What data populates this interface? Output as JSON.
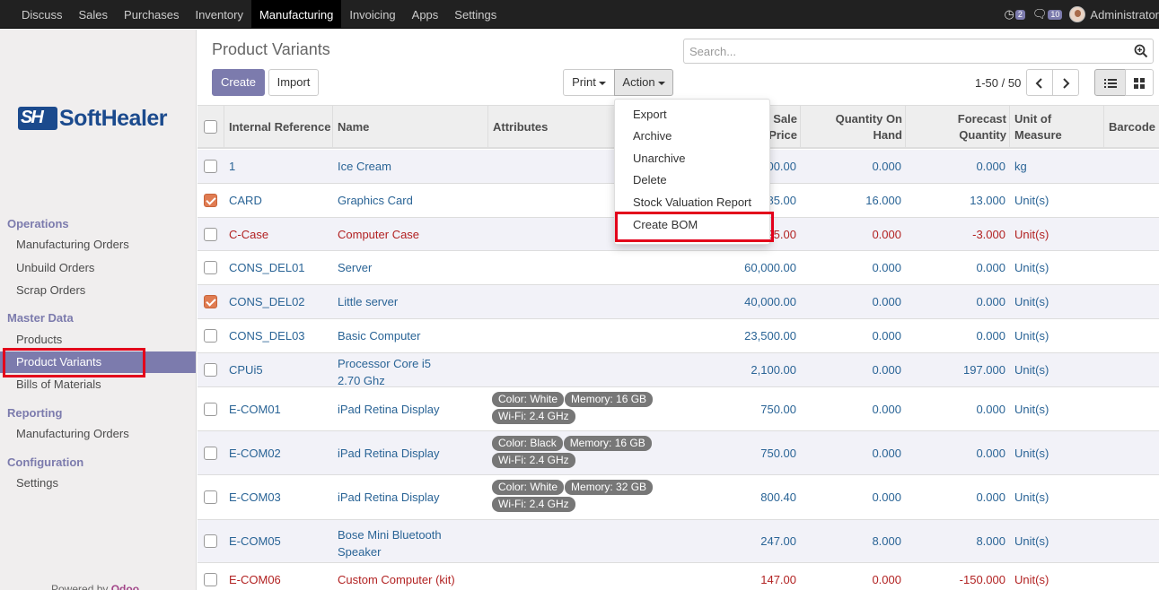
{
  "topbar": {
    "menus": [
      "Discuss",
      "Sales",
      "Purchases",
      "Inventory",
      "Manufacturing",
      "Invoicing",
      "Apps",
      "Settings"
    ],
    "active_menu": "Manufacturing",
    "activity_count": "2",
    "messages_count": "10",
    "user_name": "Administrator"
  },
  "sidebar": {
    "logo_text": "SoftHealer",
    "sections": [
      {
        "title": "Operations",
        "items": [
          "Manufacturing Orders",
          "Unbuild Orders",
          "Scrap Orders"
        ]
      },
      {
        "title": "Master Data",
        "items": [
          "Products",
          "Product Variants",
          "Bills of Materials"
        ]
      },
      {
        "title": "Reporting",
        "items": [
          "Manufacturing Orders"
        ]
      },
      {
        "title": "Configuration",
        "items": [
          "Settings"
        ]
      }
    ],
    "active_item": "Product Variants",
    "powered_by": "Powered by",
    "powered_brand": "Odoo"
  },
  "control": {
    "title": "Product Variants",
    "search_placeholder": "Search...",
    "create_label": "Create",
    "import_label": "Import",
    "print_label": "Print",
    "action_label": "Action",
    "pager": "1-50 / 50"
  },
  "action_menu": {
    "items": [
      "Export",
      "Archive",
      "Unarchive",
      "Delete",
      "Stock Valuation Report",
      "Create BOM"
    ],
    "highlighted": "Create BOM"
  },
  "table": {
    "headers": {
      "ref": "Internal Reference",
      "name": "Name",
      "attributes": "Attributes",
      "price": "Sale Price",
      "qty": "Quantity On Hand",
      "forecast": "Forecast Quantity",
      "uom": "Unit of Measure",
      "barcode": "Barcode"
    },
    "rows": [
      {
        "ref": "1",
        "name": "Ice Cream",
        "tags": [],
        "price": "100.00",
        "qty": "0.000",
        "forecast": "0.000",
        "uom": "kg",
        "checked": false,
        "red": false
      },
      {
        "ref": "CARD",
        "name": "Graphics Card",
        "tags": [],
        "price": "885.00",
        "qty": "16.000",
        "forecast": "13.000",
        "uom": "Unit(s)",
        "checked": true,
        "red": false
      },
      {
        "ref": "C-Case",
        "name": "Computer Case",
        "tags": [],
        "price": "25.00",
        "qty": "0.000",
        "forecast": "-3.000",
        "uom": "Unit(s)",
        "checked": false,
        "red": true
      },
      {
        "ref": "CONS_DEL01",
        "name": "Server",
        "tags": [],
        "price": "60,000.00",
        "qty": "0.000",
        "forecast": "0.000",
        "uom": "Unit(s)",
        "checked": false,
        "red": false
      },
      {
        "ref": "CONS_DEL02",
        "name": "Little server",
        "tags": [],
        "price": "40,000.00",
        "qty": "0.000",
        "forecast": "0.000",
        "uom": "Unit(s)",
        "checked": true,
        "red": false
      },
      {
        "ref": "CONS_DEL03",
        "name": "Basic Computer",
        "tags": [],
        "price": "23,500.00",
        "qty": "0.000",
        "forecast": "0.000",
        "uom": "Unit(s)",
        "checked": false,
        "red": false
      },
      {
        "ref": "CPUi5",
        "name": "Processor Core i5 2.70 Ghz",
        "tags": [],
        "price": "2,100.00",
        "qty": "0.000",
        "forecast": "197.000",
        "uom": "Unit(s)",
        "checked": false,
        "red": false
      },
      {
        "ref": "E-COM01",
        "name": "iPad Retina Display",
        "tags": [
          "Color: White",
          "Memory: 16 GB",
          "Wi-Fi: 2.4 GHz"
        ],
        "price": "750.00",
        "qty": "0.000",
        "forecast": "0.000",
        "uom": "Unit(s)",
        "checked": false,
        "red": false
      },
      {
        "ref": "E-COM02",
        "name": "iPad Retina Display",
        "tags": [
          "Color: Black",
          "Memory: 16 GB",
          "Wi-Fi: 2.4 GHz"
        ],
        "price": "750.00",
        "qty": "0.000",
        "forecast": "0.000",
        "uom": "Unit(s)",
        "checked": false,
        "red": false
      },
      {
        "ref": "E-COM03",
        "name": "iPad Retina Display",
        "tags": [
          "Color: White",
          "Memory: 32 GB",
          "Wi-Fi: 2.4 GHz"
        ],
        "price": "800.40",
        "qty": "0.000",
        "forecast": "0.000",
        "uom": "Unit(s)",
        "checked": false,
        "red": false
      },
      {
        "ref": "E-COM05",
        "name": "Bose Mini Bluetooth Speaker",
        "tags": [],
        "price": "247.00",
        "qty": "8.000",
        "forecast": "8.000",
        "uom": "Unit(s)",
        "checked": false,
        "red": false
      },
      {
        "ref": "E-COM06",
        "name": "Custom Computer (kit)",
        "tags": [],
        "price": "147.00",
        "qty": "0.000",
        "forecast": "-150.000",
        "uom": "Unit(s)",
        "checked": false,
        "red": true
      }
    ]
  }
}
